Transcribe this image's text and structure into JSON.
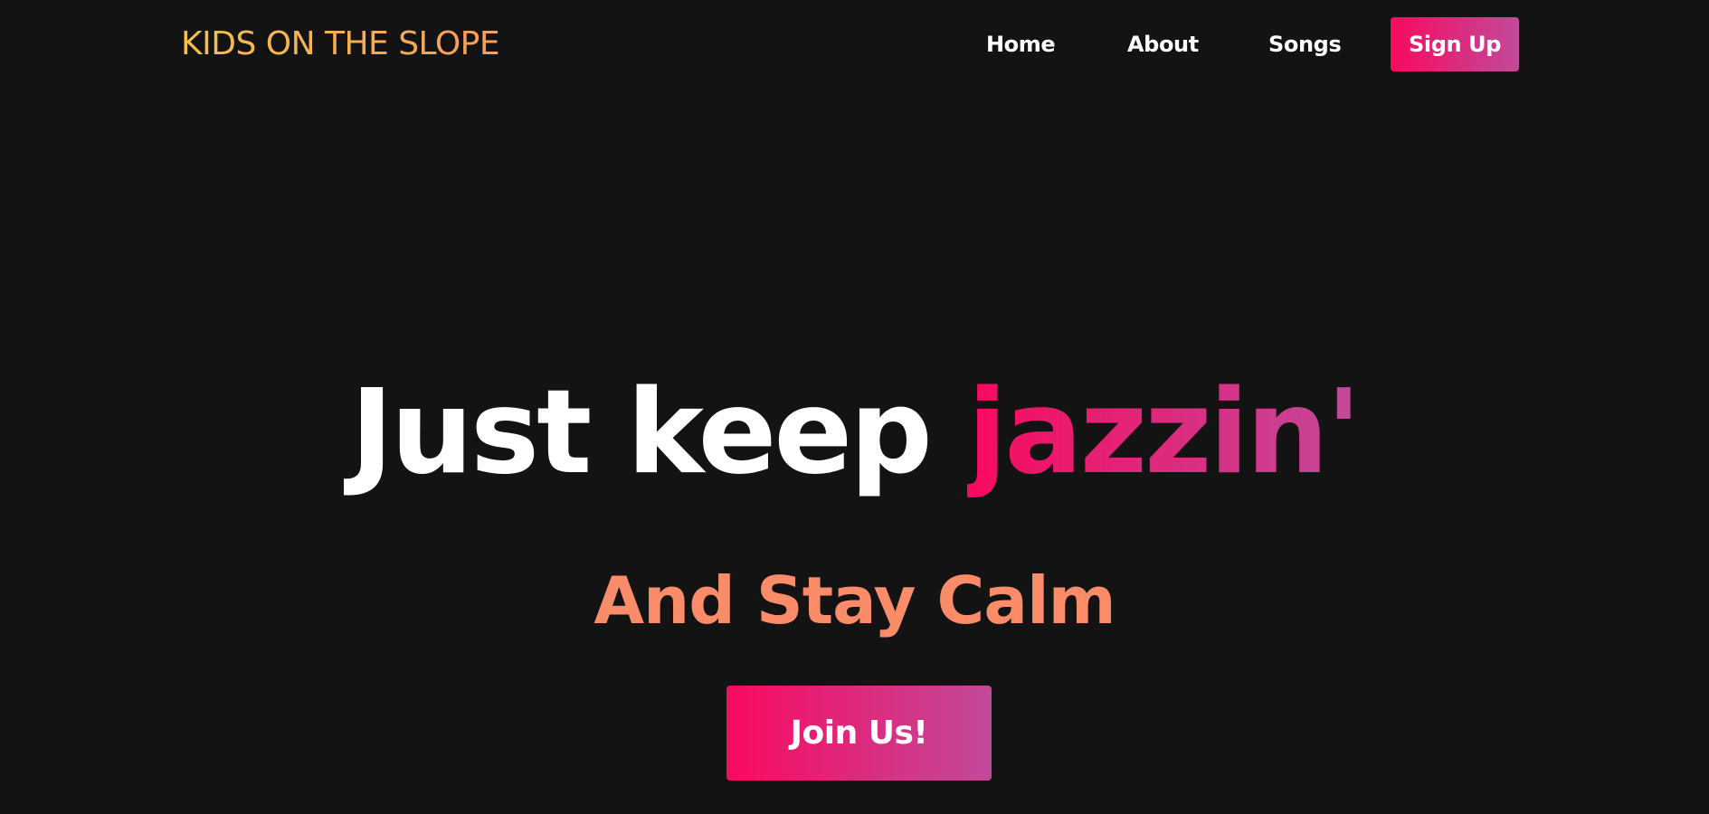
{
  "navbar": {
    "logo": "KIDS ON THE SLOPE",
    "links": [
      {
        "label": "Home"
      },
      {
        "label": "About"
      },
      {
        "label": "Songs"
      }
    ],
    "signup_label": "Sign Up"
  },
  "hero": {
    "title_main": "Just keep ",
    "title_accent": "jazzin'",
    "subtitle": "And Stay Calm",
    "cta_label": "Join Us!"
  },
  "colors": {
    "background": "#131313",
    "logo_gradient_start": "#f5c04a",
    "logo_gradient_end": "#f79e5c",
    "accent_gradient_start": "#f80a60",
    "accent_gradient_end": "#c24a9a",
    "subtitle": "#fb8c6a",
    "text": "#ffffff"
  }
}
